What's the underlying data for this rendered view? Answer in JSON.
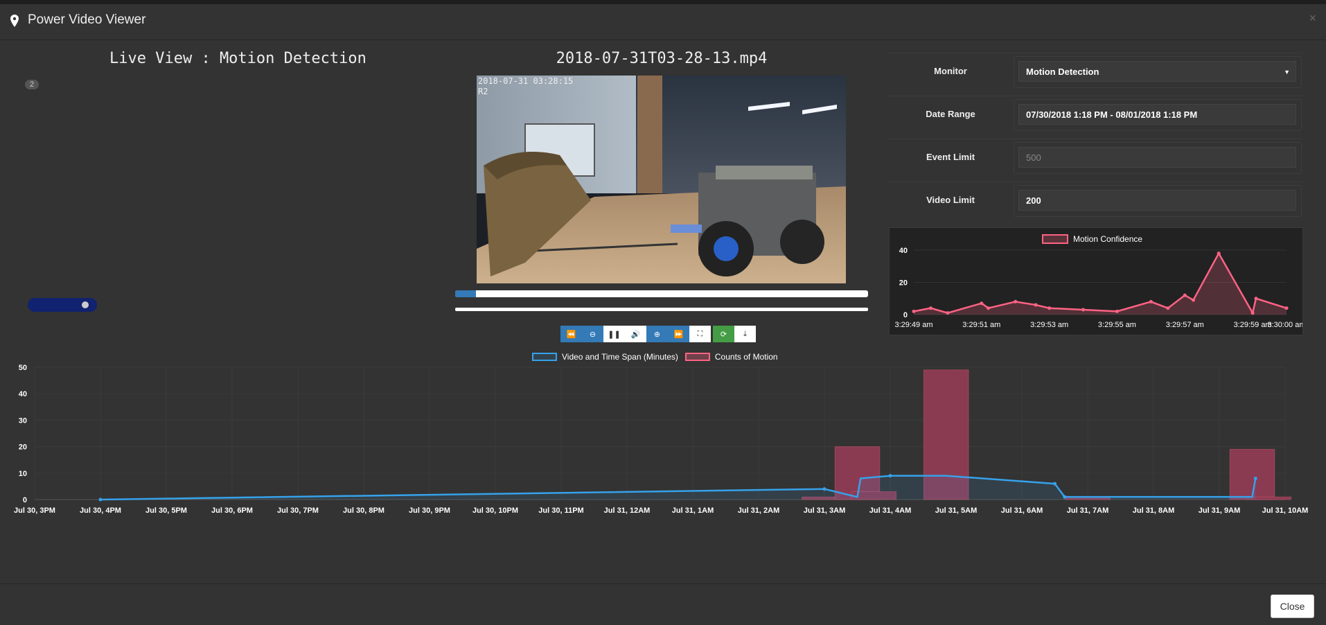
{
  "modal": {
    "title": "Power Video Viewer",
    "close_x": "×",
    "close_button": "Close"
  },
  "left": {
    "title": "Live View : Motion Detection",
    "badge": "2"
  },
  "player": {
    "filename": "2018-07-31T03-28-13.mp4",
    "overlay_timestamp": "2018-07-31 03:28:15",
    "overlay_camera": "R2",
    "progress": 0.04,
    "controls": [
      {
        "icon": "rewind-icon",
        "glyph": "⏪",
        "style": "blue"
      },
      {
        "icon": "seek-back-icon",
        "glyph": "⊖",
        "style": "blue"
      },
      {
        "icon": "pause-icon",
        "glyph": "❚❚",
        "style": "white"
      },
      {
        "icon": "volume-icon",
        "glyph": "🔊",
        "style": "white"
      },
      {
        "icon": "seek-forward-icon",
        "glyph": "⊕",
        "style": "blue"
      },
      {
        "icon": "fast-forward-icon",
        "glyph": "⏩",
        "style": "blue"
      },
      {
        "icon": "fullscreen-icon",
        "glyph": "⛶",
        "style": "white"
      },
      {
        "icon": "refresh-icon",
        "glyph": "⟳",
        "style": "green"
      },
      {
        "icon": "download-icon",
        "glyph": "⤓",
        "style": "white"
      }
    ]
  },
  "form": {
    "monitor_label": "Monitor",
    "monitor_value": "Motion Detection",
    "date_label": "Date Range",
    "date_value": "07/30/2018 1:18 PM - 08/01/2018 1:18 PM",
    "event_label": "Event Limit",
    "event_placeholder": "500",
    "video_label": "Video Limit",
    "video_value": "200"
  },
  "colors": {
    "blue": "#36a2eb",
    "pink": "#ff6384",
    "bar": "#8a3b52"
  },
  "chart_data": [
    {
      "type": "line",
      "legend": [
        "Motion Confidence"
      ],
      "x_labels": [
        "3:29:49 am",
        "3:29:51 am",
        "3:29:53 am",
        "3:29:55 am",
        "3:29:57 am",
        "3:29:59 am",
        "3:30:00 am"
      ],
      "y_ticks": [
        "40",
        "20",
        "0"
      ],
      "ylim": [
        0,
        40
      ],
      "series": [
        {
          "name": "Motion Confidence",
          "points": [
            [
              0,
              2
            ],
            [
              0.5,
              4
            ],
            [
              1,
              1
            ],
            [
              2,
              7
            ],
            [
              2.2,
              4
            ],
            [
              3,
              8
            ],
            [
              3.6,
              6
            ],
            [
              4,
              4
            ],
            [
              5,
              3
            ],
            [
              6,
              2
            ],
            [
              7,
              8
            ],
            [
              7.5,
              4
            ],
            [
              8,
              12
            ],
            [
              8.25,
              9
            ],
            [
              9,
              38
            ],
            [
              10,
              1
            ],
            [
              10.1,
              10
            ],
            [
              11,
              4
            ]
          ]
        }
      ]
    },
    {
      "type": "bar",
      "legend": [
        "Video and Time Span (Minutes)",
        "Counts of Motion"
      ],
      "x_labels": [
        "Jul 30, 3PM",
        "Jul 30, 4PM",
        "Jul 30, 5PM",
        "Jul 30, 6PM",
        "Jul 30, 7PM",
        "Jul 30, 8PM",
        "Jul 30, 9PM",
        "Jul 30, 10PM",
        "Jul 30, 11PM",
        "Jul 31, 12AM",
        "Jul 31, 1AM",
        "Jul 31, 2AM",
        "Jul 31, 3AM",
        "Jul 31, 4AM",
        "Jul 31, 5AM",
        "Jul 31, 6AM",
        "Jul 31, 7AM",
        "Jul 31, 8AM",
        "Jul 31, 9AM",
        "Jul 31, 10AM"
      ],
      "y_ticks": [
        "50",
        "40",
        "30",
        "20",
        "10",
        "0"
      ],
      "ylim": [
        0,
        50
      ],
      "bars": [
        [
          12.0,
          1
        ],
        [
          12.5,
          20
        ],
        [
          12.75,
          3
        ],
        [
          13.85,
          49
        ],
        [
          16.0,
          1
        ],
        [
          18.5,
          19
        ],
        [
          18.75,
          1
        ]
      ],
      "line": [
        [
          1,
          0
        ],
        [
          12.0,
          4
        ],
        [
          12.5,
          1
        ],
        [
          12.55,
          8
        ],
        [
          13.0,
          9
        ],
        [
          13.85,
          9
        ],
        [
          15.5,
          6
        ],
        [
          15.65,
          1
        ],
        [
          18.0,
          1
        ],
        [
          18.5,
          1
        ],
        [
          18.55,
          8
        ]
      ]
    }
  ]
}
